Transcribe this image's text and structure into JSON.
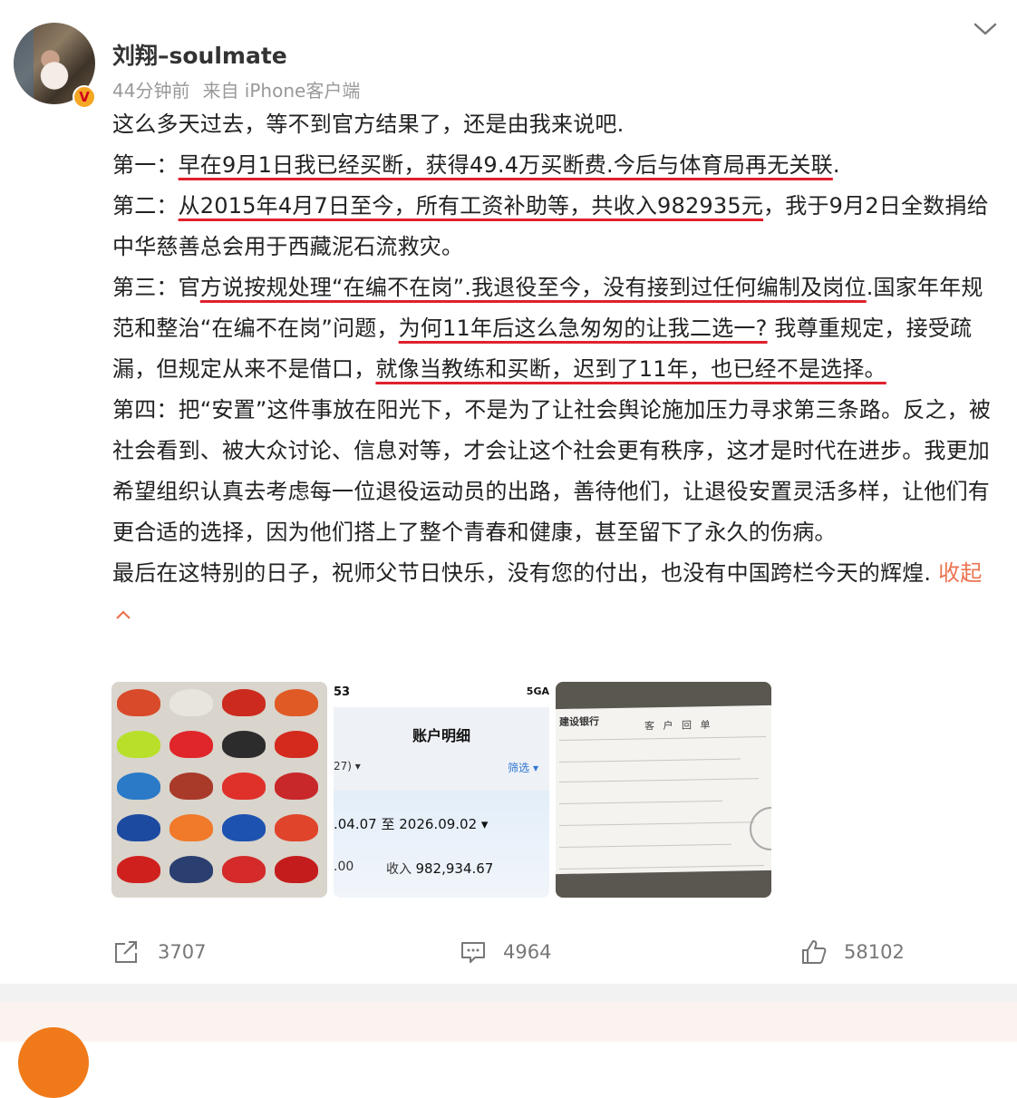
{
  "post": {
    "username": "刘翔–soulmate",
    "time": "44分钟前",
    "source": "来自 iPhone客户端",
    "verified_badge": "V",
    "paragraphs": [
      {
        "segments": [
          {
            "text": "这么多天过去，等不到官方结果了，还是由我来说吧.",
            "underline": false
          }
        ]
      },
      {
        "segments": [
          {
            "text": "第一：",
            "underline": false
          },
          {
            "text": "早在9月1日我已经买断，获得49.4万买断费.今后与体育局再无关联",
            "underline": true
          },
          {
            "text": ".",
            "underline": false
          }
        ]
      },
      {
        "segments": [
          {
            "text": "第二：",
            "underline": false
          },
          {
            "text": "从2015年4月7日至今，所有工资补助等，共收入982935元",
            "underline": true
          },
          {
            "text": "，我于9月2日全数捐给中华慈善总会用于西藏泥石流救灾。",
            "underline": false
          }
        ]
      },
      {
        "segments": [
          {
            "text": "第三：官",
            "underline": false
          },
          {
            "text": "方说按规处理“在编不在岗”.我退役至今，没有接到过任何编制及岗位",
            "underline": true
          },
          {
            "text": ".国家年年规范和整治“在编不在岗”问题，",
            "underline": false
          },
          {
            "text": "为何11年后这么急匆匆的让我二选一?",
            "underline": true
          },
          {
            "text": " 我尊重规定，接受疏漏，但规定从来不是借口，",
            "underline": false
          },
          {
            "text": "就像当教练和买断，迟到了11年，也已经不是选择。",
            "underline": true
          }
        ]
      },
      {
        "segments": [
          {
            "text": "第四：把“安置”这件事放在阳光下，不是为了让社会舆论施加压力寻求第三条路。反之，被社会看到、被大众讨论、信息对等，才会让这个社会更有秩序，这才是时代在进步。我更加希望组织认真去考虑每一位退役运动员的出路，善待他们，让退役安置灵活多样，让他们有更合适的选择，因为他们搭上了整个青春和健康，甚至留下了永久的伤病。",
            "underline": false
          }
        ]
      },
      {
        "segments": [
          {
            "text": "最后在这特别的日子，祝师父节日快乐，没有您的付出，也没有中国跨栏今天的辉煌. ",
            "underline": false
          }
        ]
      }
    ],
    "collapse_label": "收起",
    "collapse_arrow": "^"
  },
  "images": {
    "thumb2": {
      "carrier": "53",
      "signal": "5GA",
      "title": "账户明细",
      "filter_left": "27) ▾",
      "filter_right": "筛选 ▾",
      "range": ".04.07 至 2026.09.02 ▾",
      "amount_left": ".00",
      "amount_label": "收入",
      "amount_value": "982,934.67"
    },
    "thumb3": {
      "bank": "建设银行",
      "receipt_title": "客 户 回 单"
    }
  },
  "actions": {
    "share_count": "3707",
    "comment_count": "4964",
    "like_count": "58102"
  },
  "colors": {
    "accent": "#eb7350",
    "underline": "#e0202e",
    "meta": "#999999",
    "icon": "#777777"
  },
  "icons": {
    "chevron": "chevron-down-icon",
    "share": "share-icon",
    "comment": "comment-icon",
    "like": "thumbs-up-icon"
  }
}
